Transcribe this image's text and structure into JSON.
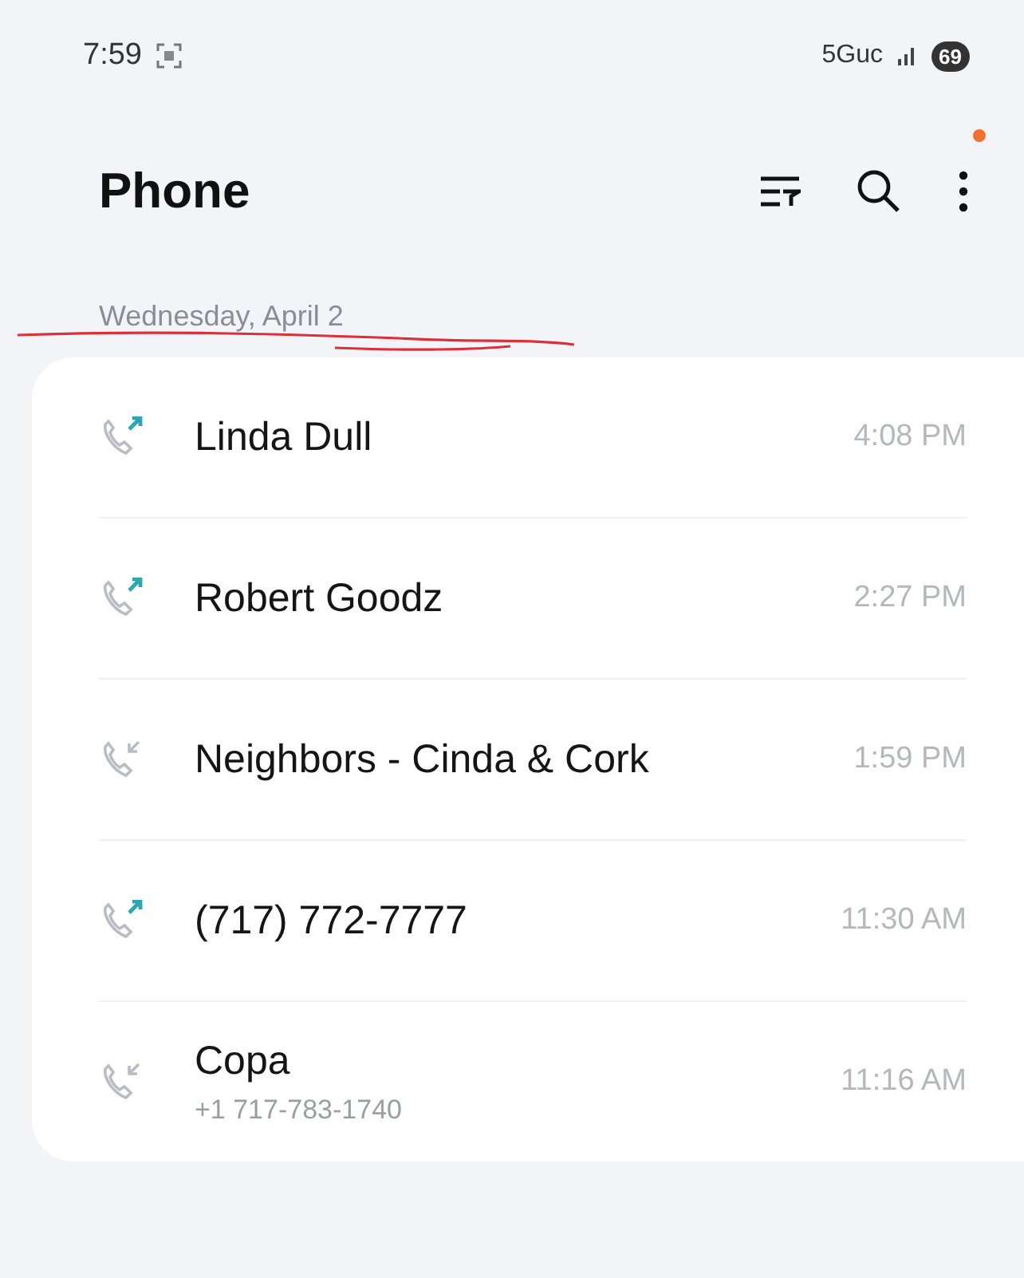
{
  "status_bar": {
    "time": "7:59",
    "network": "5Guc",
    "battery": "69"
  },
  "header": {
    "title": "Phone",
    "notification_dot": true
  },
  "date_heading": "Wednesday, April 2",
  "calls": [
    {
      "name": "Linda Dull",
      "kind": "outgoing",
      "time": "4:08 PM"
    },
    {
      "name": "Robert Goodz",
      "kind": "outgoing",
      "time": "2:27 PM"
    },
    {
      "name": "Neighbors - Cinda & Cork",
      "kind": "incoming",
      "time": "1:59 PM"
    },
    {
      "name": "(717) 772-7777",
      "kind": "outgoing",
      "time": "11:30 AM"
    },
    {
      "name": "Copa",
      "number": "+1 717-783-1740",
      "kind": "incoming",
      "time": "11:16 AM"
    }
  ]
}
